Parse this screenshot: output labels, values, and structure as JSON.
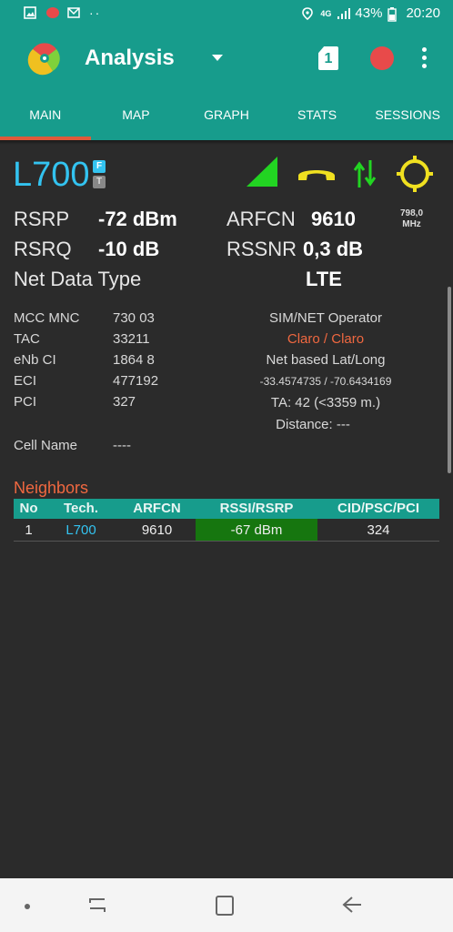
{
  "status_bar": {
    "network": "4G",
    "battery": "43%",
    "time": "20:20"
  },
  "appbar": {
    "title": "Analysis",
    "sim_slot": "1"
  },
  "tabs": [
    "MAIN",
    "MAP",
    "GRAPH",
    "STATS",
    "SESSIONS"
  ],
  "serving": {
    "tech": "L700",
    "tag_f": "F",
    "tag_t": "T",
    "rsrp_label": "RSRP",
    "rsrp_value": "-72 dBm",
    "rsrq_label": "RSRQ",
    "rsrq_value": "-10 dB",
    "arfcn_label": "ARFCN",
    "arfcn_value": "9610",
    "freq_value": "798,0",
    "freq_unit": "MHz",
    "rssnr_label": "RSSNR",
    "rssnr_value": "0,3 dB",
    "net_type_label": "Net Data Type",
    "net_type_value": "LTE"
  },
  "cell_info": {
    "mcc_mnc_label": "MCC MNC",
    "mcc_mnc_value": "730 03",
    "tac_label": "TAC",
    "tac_value": "33211",
    "enb_label": "eNb CI",
    "enb_value": "1864 8",
    "eci_label": "ECI",
    "eci_value": "477192",
    "pci_label": "PCI",
    "pci_value": "327",
    "cell_name_label": "Cell Name",
    "cell_name_value": "----",
    "operator_label": "SIM/NET Operator",
    "operator_value": "Claro / Claro",
    "latlong_label": "Net based Lat/Long",
    "latlong_value": "-33.4574735 / -70.6434169",
    "ta_value": "TA: 42 (<3359 m.)",
    "distance_value": "Distance: ---"
  },
  "neighbors": {
    "title": "Neighbors",
    "columns": [
      "No",
      "Tech.",
      "ARFCN",
      "RSSI/RSRP",
      "CID/PSC/PCI"
    ],
    "rows": [
      {
        "no": "1",
        "tech": "L700",
        "arfcn": "9610",
        "rssi": "-67 dBm",
        "cid": "324"
      }
    ]
  },
  "colors": {
    "accent": "#179c8c",
    "tech_blue": "#33c3f0",
    "orange": "#f06840",
    "signal_green": "#22d422",
    "yellow": "#f0e020"
  }
}
